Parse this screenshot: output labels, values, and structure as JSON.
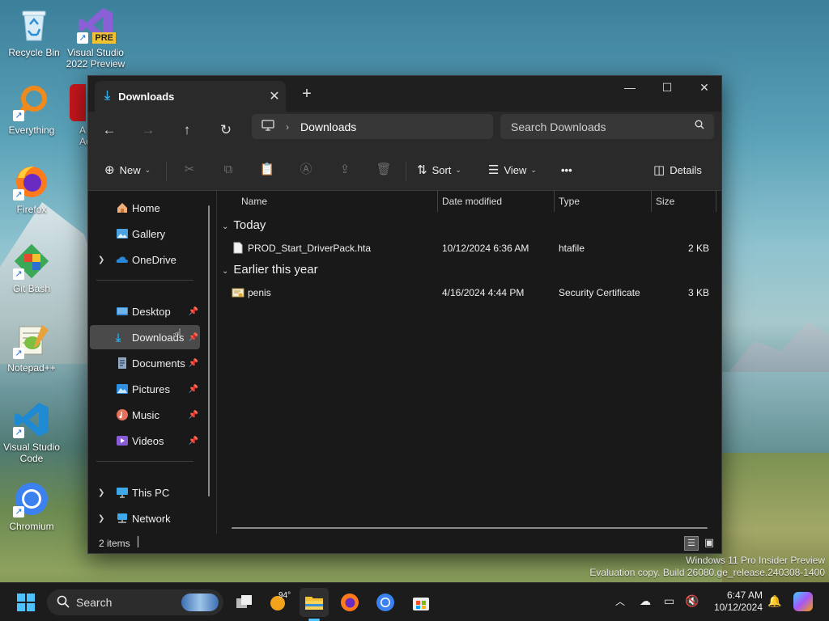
{
  "desktop": {
    "icons": [
      {
        "label": "Recycle Bin",
        "icon": "recycle-bin-icon"
      },
      {
        "label": "Visual Studio 2022 Preview",
        "icon": "visual-studio-preview-icon",
        "badge": "PRE"
      },
      {
        "label": "Everything",
        "icon": "everything-search-icon"
      },
      {
        "label": "A Ac",
        "icon": "acrobat-icon"
      },
      {
        "label": "Firefox",
        "icon": "firefox-icon"
      },
      {
        "label": "Git Bash",
        "icon": "git-bash-icon"
      },
      {
        "label": "Notepad++",
        "icon": "notepad-plus-plus-icon"
      },
      {
        "label": "Visual Studio Code",
        "icon": "vscode-icon"
      },
      {
        "label": "Chromium",
        "icon": "chromium-icon"
      }
    ],
    "watermark": {
      "line1": "Windows 11 Pro Insider Preview",
      "line2": "Evaluation copy. Build 26080.ge_release.240308-1400"
    }
  },
  "explorer": {
    "tab": {
      "title": "Downloads",
      "close": "✕",
      "new_tab": "+"
    },
    "window_controls": {
      "minimize": "—",
      "maximize": "☐",
      "close": "✕"
    },
    "nav": {
      "back": "←",
      "forward": "→",
      "up": "↑",
      "refresh": "↻"
    },
    "address": {
      "location": "Downloads",
      "separator": "›"
    },
    "search": {
      "placeholder": "Search Downloads"
    },
    "toolbar": {
      "new_label": "New",
      "sort_label": "Sort",
      "view_label": "View",
      "more_label": "•••",
      "details_label": "Details"
    },
    "sidebar": {
      "items": [
        {
          "label": "Home",
          "expandable": false,
          "pinned": false
        },
        {
          "label": "Gallery",
          "expandable": false,
          "pinned": false
        },
        {
          "label": "OneDrive",
          "expandable": true,
          "pinned": false
        },
        {
          "label": "Desktop",
          "expandable": false,
          "pinned": true
        },
        {
          "label": "Downloads",
          "expandable": false,
          "pinned": true,
          "selected": true
        },
        {
          "label": "Documents",
          "expandable": false,
          "pinned": true
        },
        {
          "label": "Pictures",
          "expandable": false,
          "pinned": true
        },
        {
          "label": "Music",
          "expandable": false,
          "pinned": true
        },
        {
          "label": "Videos",
          "expandable": false,
          "pinned": true
        },
        {
          "label": "This PC",
          "expandable": true,
          "pinned": false
        },
        {
          "label": "Network",
          "expandable": true,
          "pinned": false
        }
      ]
    },
    "columns": {
      "name": "Name",
      "date": "Date modified",
      "type": "Type",
      "size": "Size"
    },
    "groups": [
      {
        "title": "Today",
        "files": [
          {
            "name": "PROD_Start_DriverPack.hta",
            "date": "10/12/2024 6:36 AM",
            "type": "htafile",
            "size": "2 KB",
            "icon": "file-icon"
          }
        ]
      },
      {
        "title": "Earlier this year",
        "files": [
          {
            "name": "penis",
            "date": "4/16/2024 4:44 PM",
            "type": "Security Certificate",
            "size": "3 KB",
            "icon": "certificate-icon"
          }
        ]
      }
    ],
    "status": {
      "count": "2 items"
    }
  },
  "taskbar": {
    "search_label": "Search",
    "weather": "94°",
    "clock": {
      "time": "6:47 AM",
      "date": "10/12/2024"
    },
    "apps": [
      "start-icon",
      "task-view-icon",
      "weather-icon",
      "file-explorer-icon",
      "firefox-icon",
      "chromium-icon",
      "microsoft-store-icon"
    ]
  },
  "colors": {
    "accent": "#2ea8e5",
    "window_bg": "#191919",
    "toolbar_bg": "#2a2a2a",
    "selected": "#4a4a4a"
  }
}
